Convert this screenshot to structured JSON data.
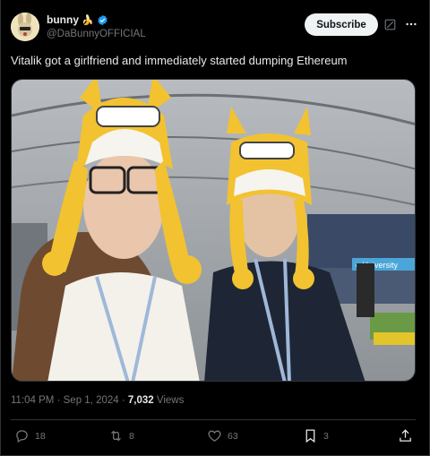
{
  "post": {
    "display_name": "bunny",
    "name_emoji": "🍌",
    "handle": "@DaBunnyOFFICIAL",
    "subscribe_label": "Subscribe",
    "text": "Vitalik got a girlfriend and immediately started dumping Ethereum",
    "time": "11:04 PM",
    "date": "Sep 1, 2024",
    "views_count": "7,032",
    "views_label": "Views",
    "separator": "·"
  },
  "media_overlay": {
    "banner_text": "e University"
  },
  "actions": {
    "replies": "18",
    "reposts": "8",
    "likes": "63",
    "bookmarks": "3"
  },
  "colors": {
    "background": "#000000",
    "text": "#e7e9ea",
    "muted": "#71767b",
    "verified": "#1d9bf0",
    "border": "#2f3336"
  },
  "icons": {
    "verified": "verified-badge-icon",
    "grok": "grok-icon",
    "more": "more-icon",
    "reply": "reply-icon",
    "repost": "repost-icon",
    "like": "heart-icon",
    "bookmark": "bookmark-icon",
    "share": "share-icon"
  }
}
